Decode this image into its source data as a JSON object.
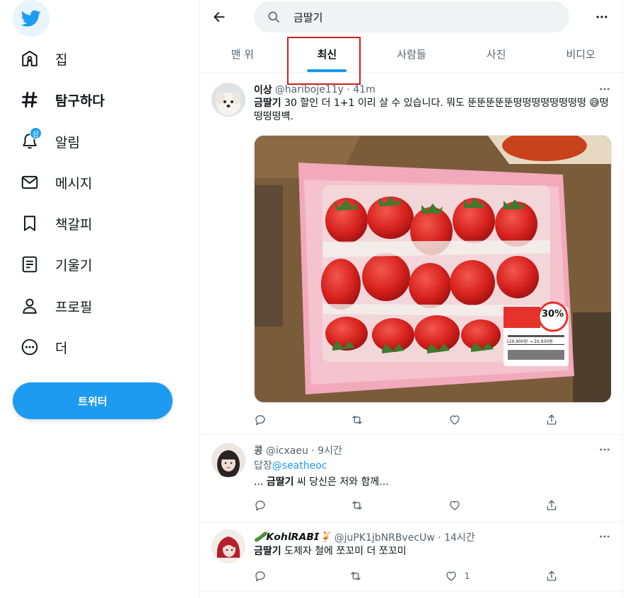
{
  "sidebar": {
    "items": [
      {
        "label": "집",
        "icon": "home-icon"
      },
      {
        "label": "탐구하다",
        "icon": "hashtag-icon"
      },
      {
        "label": "알림",
        "icon": "bell-icon",
        "badge": "삼"
      },
      {
        "label": "메시지",
        "icon": "envelope-icon"
      },
      {
        "label": "책갈피",
        "icon": "bookmark-icon"
      },
      {
        "label": "기울기",
        "icon": "list-icon"
      },
      {
        "label": "프로필",
        "icon": "person-icon"
      },
      {
        "label": "더",
        "icon": "more-circle-icon"
      }
    ],
    "tweet_button": "트위터"
  },
  "search": {
    "value": "금딸기",
    "placeholder": ""
  },
  "tabs": [
    {
      "label": "맨 위"
    },
    {
      "label": "최신"
    },
    {
      "label": "사람들"
    },
    {
      "label": "사진"
    },
    {
      "label": "비디오"
    }
  ],
  "tweets": [
    {
      "name": "이상",
      "handle": "@hariboje11y · 41m",
      "highlight": "금딸기",
      "text": " 30 할인 더 1+1 이리 살 수 있습니다. 뭐도 뚠뚠뚠뚠뚠떵떵떵떵떵떵떵떵 😅떵떵떵떵뱩.",
      "actions": {
        "reply": "",
        "retweet": "",
        "like": ""
      },
      "media": {
        "price_tag": "30%",
        "price_text": "129,900원 → 20,930원"
      }
    },
    {
      "name": "콩",
      "handle": "@icxaeu · 9시간",
      "reply_prefix": "답장",
      "reply_to": "@seatheoc",
      "pre": "... ",
      "highlight": "금딸기",
      "text": " 씨 당신은 저와 함께...",
      "actions": {
        "reply": "",
        "retweet": "",
        "like": ""
      }
    },
    {
      "name": "🥒𝙆𝙤𝙝𝙡𝙍𝘼𝘽𝙄🍹",
      "handle": "@juPK1jbNRBvecUw · 14시간",
      "highlight": "금딸기",
      "text": " 도제자 철에 쪼꼬미 더 쪼꼬미",
      "actions": {
        "reply": "",
        "retweet": "",
        "like": "1"
      }
    }
  ],
  "colors": {
    "accent": "#1d9bf0",
    "highlight_box": "#d11d1d",
    "text": "#0f1419",
    "muted": "#536471"
  }
}
